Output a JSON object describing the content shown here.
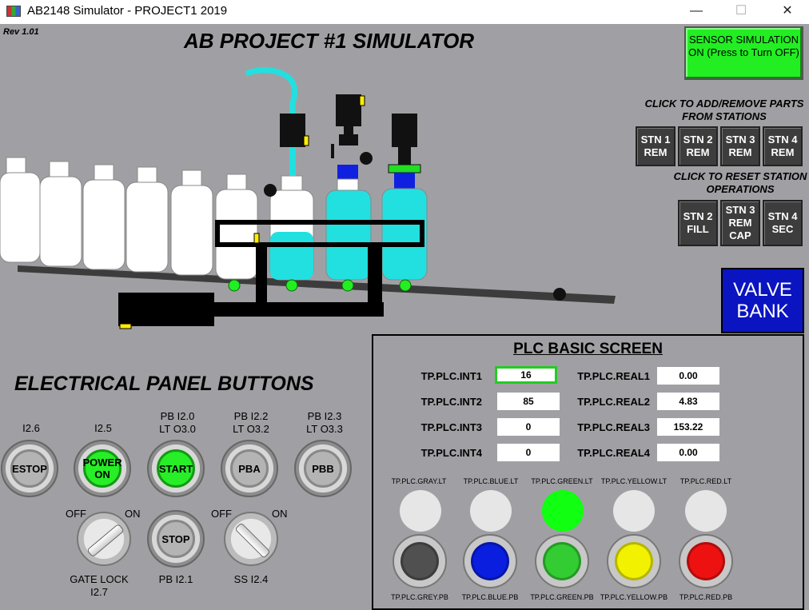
{
  "window": {
    "title": "AB2148 Simulator - PROJECT1 2019",
    "minimize": "—",
    "maximize": "☐",
    "close": "✕"
  },
  "rev": "Rev 1.01",
  "main_title": "AB PROJECT #1 SIMULATOR",
  "sensor_button": "SENSOR SIMULATION ON (Press to Turn OFF)",
  "stations": {
    "add_remove_header": "CLICK TO ADD/REMOVE PARTS FROM STATIONS",
    "remove_buttons": [
      "STN 1 REM",
      "STN 2 REM",
      "STN 3 REM",
      "STN 4 REM"
    ],
    "reset_header": "CLICK TO RESET STATION OPERATIONS",
    "reset_buttons": [
      "STN 2 FILL",
      "STN 3 REM CAP",
      "STN 4 SEC"
    ]
  },
  "valve_bank": "VALVE BANK",
  "electrical": {
    "title": "ELECTRICAL PANEL BUTTONS",
    "buttons": [
      {
        "label": "I2.6",
        "cap": "ESTOP",
        "lit": false
      },
      {
        "label": "I2.5",
        "cap": "POWER ON",
        "lit": true
      },
      {
        "label": "PB I2.0\nLT O3.0",
        "cap": "START",
        "lit": true
      },
      {
        "label": "PB I2.2\nLT O3.2",
        "cap": "PBA",
        "lit": false
      },
      {
        "label": "PB I2.3\nLT O3.3",
        "cap": "PBB",
        "lit": false
      }
    ],
    "gate_lock": {
      "off": "OFF",
      "on": "ON",
      "label": "GATE LOCK\nI2.7"
    },
    "stop": {
      "cap": "STOP",
      "label": "PB I2.1"
    },
    "ss": {
      "off": "OFF",
      "on": "ON",
      "label": "SS I2.4"
    }
  },
  "plc": {
    "title": "PLC BASIC SCREEN",
    "ints": [
      {
        "tag": "TP.PLC.INT1",
        "value": "16"
      },
      {
        "tag": "TP.PLC.INT2",
        "value": "85"
      },
      {
        "tag": "TP.PLC.INT3",
        "value": "0"
      },
      {
        "tag": "TP.PLC.INT4",
        "value": "0"
      }
    ],
    "reals": [
      {
        "tag": "TP.PLC.REAL1",
        "value": "0.00"
      },
      {
        "tag": "TP.PLC.REAL2",
        "value": "4.83"
      },
      {
        "tag": "TP.PLC.REAL3",
        "value": "153.22"
      },
      {
        "tag": "TP.PLC.REAL4",
        "value": "0.00"
      }
    ],
    "lights": [
      {
        "label": "TP.PLC.GRAY.LT",
        "on": false,
        "color": "#e6e6e6"
      },
      {
        "label": "TP.PLC.BLUE.LT",
        "on": false,
        "color": "#e6e6e6"
      },
      {
        "label": "TP.PLC.GREEN.LT",
        "on": true,
        "color": "#11ff11"
      },
      {
        "label": "TP.PLC.YELLOW.LT",
        "on": false,
        "color": "#e6e6e6"
      },
      {
        "label": "TP.PLC.RED.LT",
        "on": false,
        "color": "#e6e6e6"
      }
    ],
    "pushbuttons": [
      {
        "label": "TP.PLC.GREY.PB",
        "color": "#505050"
      },
      {
        "label": "TP.PLC.BLUE.PB",
        "color": "#0a1ee0"
      },
      {
        "label": "TP.PLC.GREEN.PB",
        "color": "#33cc33"
      },
      {
        "label": "TP.PLC.YELLOW.PB",
        "color": "#f2f200"
      },
      {
        "label": "TP.PLC.RED.PB",
        "color": "#ee1111"
      }
    ]
  }
}
